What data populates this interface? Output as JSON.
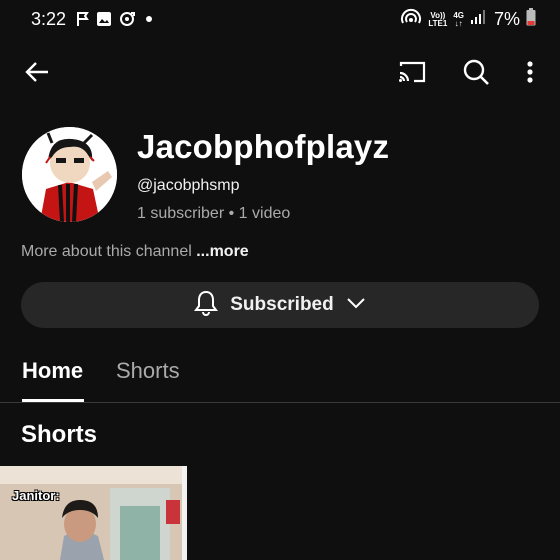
{
  "status_bar": {
    "time": "3:22",
    "battery_percent": "7%",
    "network_top": "Vo)) ",
    "network_bottom": "LTE1",
    "network_type": "4G",
    "icons": [
      "flag-icon",
      "image-icon",
      "sync-icon",
      "dot-icon",
      "hotspot-icon",
      "signal-icon",
      "battery-icon"
    ]
  },
  "top_bar": {
    "icons": [
      "back-arrow-icon",
      "cast-icon",
      "search-icon",
      "more-vert-icon"
    ]
  },
  "channel": {
    "name": "Jacobphofplayz",
    "handle": "@jacobphsmp",
    "subscribers": "1 subscriber",
    "separator": "•",
    "videos": "1 video",
    "about_text": "More about this channel",
    "about_more": "...more"
  },
  "subscribe_button": {
    "label": "Subscribed",
    "icons": [
      "bell-icon",
      "chevron-down-icon"
    ]
  },
  "tabs": [
    {
      "label": "Home",
      "selected": true
    },
    {
      "label": "Shorts",
      "selected": false
    }
  ],
  "sections": {
    "shorts_title": "Shorts"
  },
  "shorts": [
    {
      "caption": "Janitor:"
    }
  ],
  "colors": {
    "background": "#0f0f0f",
    "button_bg": "#272727",
    "secondary_text": "#aaaaaa",
    "avatar_accent": "#d01818"
  }
}
